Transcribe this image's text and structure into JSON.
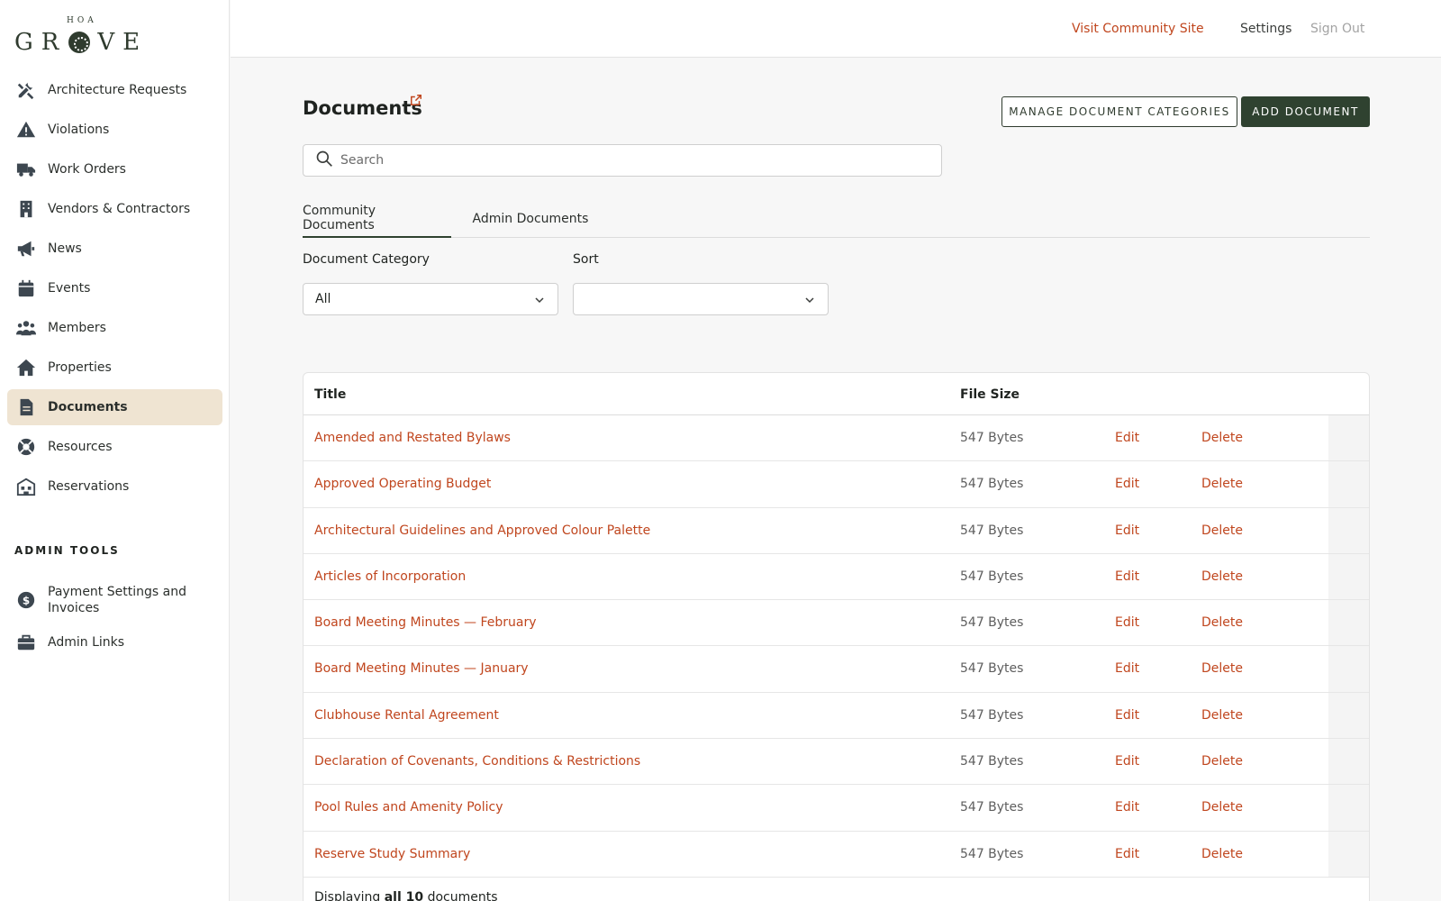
{
  "brand": {
    "top": "HOA",
    "name_left": "GR",
    "name_right": "VE"
  },
  "topbar": {
    "visit": "Visit Community Site",
    "settings": "Settings",
    "signout": "Sign Out"
  },
  "sidebar": {
    "items": [
      {
        "label": "Architecture Requests",
        "icon": "tools-icon"
      },
      {
        "label": "Violations",
        "icon": "warning-icon"
      },
      {
        "label": "Work Orders",
        "icon": "truck-icon"
      },
      {
        "label": "Vendors & Contractors",
        "icon": "building-icon"
      },
      {
        "label": "News",
        "icon": "megaphone-icon"
      },
      {
        "label": "Events",
        "icon": "calendar-icon"
      },
      {
        "label": "Members",
        "icon": "users-icon"
      },
      {
        "label": "Properties",
        "icon": "home-icon"
      },
      {
        "label": "Documents",
        "icon": "document-icon",
        "active": true
      },
      {
        "label": "Resources",
        "icon": "lifebuoy-icon"
      },
      {
        "label": "Reservations",
        "icon": "reservation-icon"
      }
    ],
    "admin_heading": "ADMIN TOOLS",
    "admin_items": [
      {
        "label": "Payment Settings and Invoices",
        "icon": "dollar-icon"
      },
      {
        "label": "Admin Links",
        "icon": "briefcase-icon"
      }
    ]
  },
  "page": {
    "title": "Documents",
    "manage_categories": "MANAGE DOCUMENT CATEGORIES",
    "add_document": "ADD DOCUMENT",
    "search_placeholder": "Search",
    "tabs": [
      "Community Documents",
      "Admin Documents"
    ],
    "filters": {
      "category_label": "Document Category",
      "category_value": "All",
      "sort_label": "Sort",
      "sort_value": ""
    }
  },
  "table": {
    "headers": [
      "Title",
      "File Size"
    ],
    "rows": [
      {
        "title": "Amended and Restated Bylaws",
        "size": "547 Bytes",
        "edit": "Edit",
        "delete": "Delete"
      },
      {
        "title": "Approved Operating Budget",
        "size": "547 Bytes",
        "edit": "Edit",
        "delete": "Delete"
      },
      {
        "title": "Architectural Guidelines and Approved Colour Palette",
        "size": "547 Bytes",
        "edit": "Edit",
        "delete": "Delete"
      },
      {
        "title": "Articles of Incorporation",
        "size": "547 Bytes",
        "edit": "Edit",
        "delete": "Delete"
      },
      {
        "title": "Board Meeting Minutes — February",
        "size": "547 Bytes",
        "edit": "Edit",
        "delete": "Delete"
      },
      {
        "title": "Board Meeting Minutes — January",
        "size": "547 Bytes",
        "edit": "Edit",
        "delete": "Delete"
      },
      {
        "title": "Clubhouse Rental Agreement",
        "size": "547 Bytes",
        "edit": "Edit",
        "delete": "Delete"
      },
      {
        "title": "Declaration of Covenants, Conditions & Restrictions",
        "size": "547 Bytes",
        "edit": "Edit",
        "delete": "Delete"
      },
      {
        "title": "Pool Rules and Amenity Policy",
        "size": "547 Bytes",
        "edit": "Edit",
        "delete": "Delete"
      },
      {
        "title": "Reserve Study Summary",
        "size": "547 Bytes",
        "edit": "Edit",
        "delete": "Delete"
      }
    ],
    "footer": {
      "prefix": "Displaying ",
      "bold": "all 10",
      "suffix": " documents"
    }
  },
  "colors": {
    "accent": "#c0461e",
    "primary": "#2f4230",
    "active_nav": "#efe4d2"
  }
}
